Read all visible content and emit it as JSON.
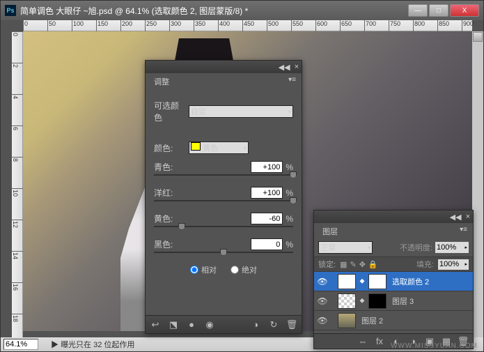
{
  "titlebar": {
    "title": "简单调色 大眼仔 ~旭.psd @ 64.1% (选取颜色 2, 图层蒙版/8) *"
  },
  "win": {
    "min": "—",
    "max": "□",
    "close": "X"
  },
  "ruler_h": [
    "0",
    "50",
    "100",
    "150",
    "200",
    "250",
    "300",
    "350",
    "400",
    "450",
    "500",
    "550",
    "600",
    "650",
    "700",
    "750",
    "800",
    "850",
    "900"
  ],
  "ruler_v": [
    "0",
    "2",
    "4",
    "6",
    "8",
    "10",
    "12",
    "14",
    "16",
    "18"
  ],
  "status": {
    "zoom": "64.1%",
    "info": "曝光只在 32 位起作用"
  },
  "adj": {
    "tab": "调整",
    "section": "可选颜色",
    "preset": "自定",
    "color_label": "颜色:",
    "color_value": "黄色",
    "sliders": [
      {
        "label": "青色:",
        "value": "+100",
        "pos": 100
      },
      {
        "label": "洋红:",
        "value": "+100",
        "pos": 100
      },
      {
        "label": "黄色:",
        "value": "-60",
        "pos": 20
      },
      {
        "label": "黑色:",
        "value": "0",
        "pos": 50
      }
    ],
    "radio_relative": "相对",
    "radio_absolute": "绝对"
  },
  "layers": {
    "tab": "图层",
    "blend": "正常",
    "opacity_label": "不透明度:",
    "opacity": "100%",
    "lock_label": "锁定:",
    "fill_label": "填充:",
    "fill": "100%",
    "items": [
      {
        "name": "选取颜色 2",
        "sel": true,
        "adj": true
      },
      {
        "name": "图层 3",
        "sel": false,
        "checker": true,
        "mask": true
      },
      {
        "name": "图层 2",
        "sel": false,
        "img": true
      }
    ]
  },
  "watermark": "WWW.MISSYUAN.COM"
}
